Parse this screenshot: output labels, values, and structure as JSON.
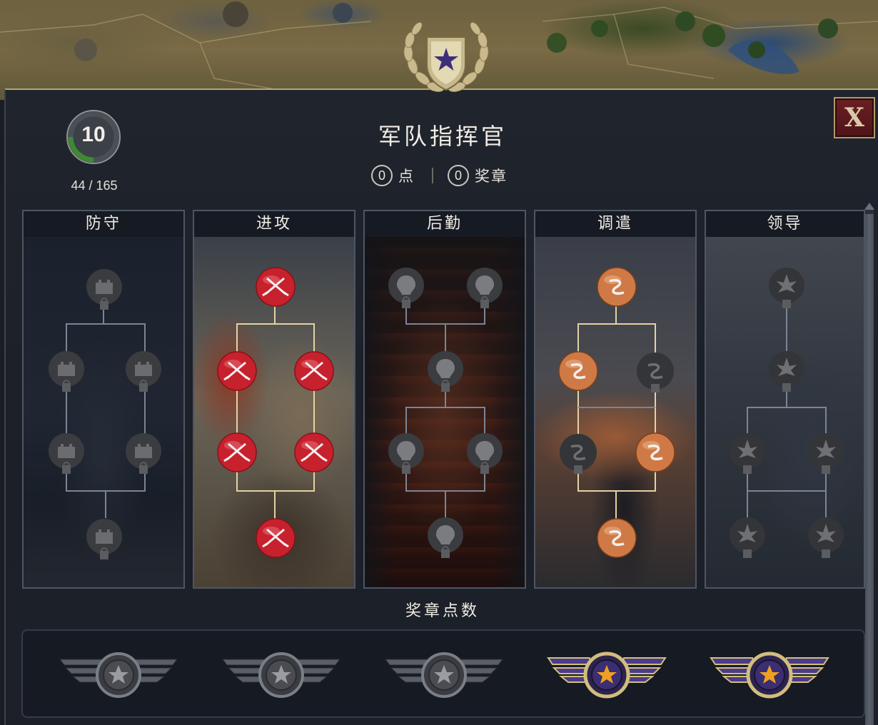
{
  "header": {
    "title": "军队指挥官",
    "level": "10",
    "xp": "44 / 165",
    "points_count": "0",
    "points_label": "点",
    "medals_count": "0",
    "medals_label": "奖章",
    "close_label": "X"
  },
  "columns": [
    {
      "id": "defense",
      "title": "防守",
      "state": "locked"
    },
    {
      "id": "attack",
      "title": "进攻",
      "state": "unlocked"
    },
    {
      "id": "logistics",
      "title": "后勤",
      "state": "locked"
    },
    {
      "id": "dispatch",
      "title": "调遣",
      "state": "partial"
    },
    {
      "id": "leadership",
      "title": "领导",
      "state": "locked"
    }
  ],
  "medal_section": {
    "title": "奖章点数",
    "medals": [
      {
        "state": "inactive"
      },
      {
        "state": "inactive"
      },
      {
        "state": "inactive"
      },
      {
        "state": "active"
      },
      {
        "state": "active"
      }
    ]
  },
  "colors": {
    "gold_border": "#b7a679",
    "attack_red": "#c7212e",
    "dispatch_orange": "#d97a3e",
    "medal_purple": "#4a3c8a",
    "locked_gray": "#4a4a4a"
  }
}
